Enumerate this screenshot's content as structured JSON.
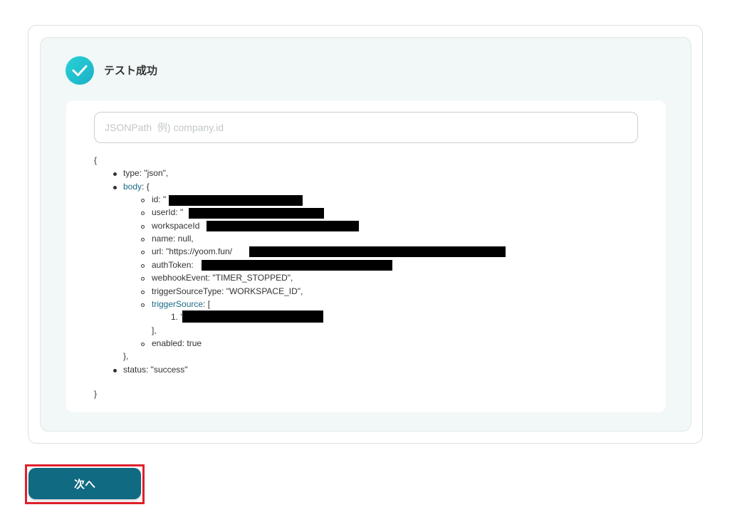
{
  "result": {
    "title": "テスト成功",
    "status_icon": "check-circle-icon"
  },
  "search": {
    "placeholder": "JSONPath  例) company.id",
    "value": ""
  },
  "json_view": {
    "open_brace": "{",
    "close_brace": "}",
    "type_line": "type: \"json\",",
    "body_key": "body",
    "body_open": ": {",
    "body_fields": {
      "id": "id: \"",
      "userId": "userId: \"",
      "workspaceId": "workspaceId",
      "name": "name: null,",
      "url": "url: \"https://yoom.fun/",
      "authToken": "authToken:",
      "webhookEvent": "webhookEvent: \"TIMER_STOPPED\",",
      "triggerSourceType": "triggerSourceType: \"WORKSPACE_ID\",",
      "triggerSource_key": "triggerSource",
      "triggerSource_open": ": [",
      "triggerSource_item": "1. \"",
      "triggerSource_close": "],",
      "enabled": "enabled: true"
    },
    "body_close": "},",
    "status_line": "status: \"success\""
  },
  "footer": {
    "next_label": "次へ"
  }
}
